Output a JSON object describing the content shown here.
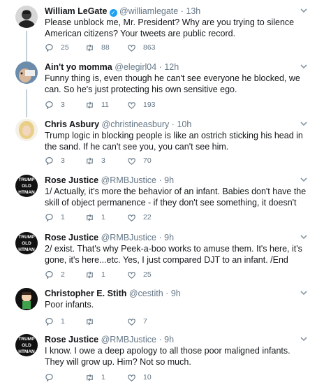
{
  "tweets": [
    {
      "name": "William LeGate",
      "verified": true,
      "handle": "@williamlegate",
      "time": "13h",
      "text": "Please unblock me, Mr. President? Why are you trying to silence American citizens? Your tweets are public record.",
      "replies": "25",
      "retweets": "88",
      "likes": "863",
      "avatar": "avatar-photo-man"
    },
    {
      "name": "Ain't yo momma",
      "verified": false,
      "handle": "@elegirl04",
      "time": "12h",
      "text": "Funny thing is, even though he can't see everyone he blocked, we can. So he's just protecting his own sensitive ego.",
      "replies": "3",
      "retweets": "11",
      "likes": "193",
      "avatar": "avatar-photo-face"
    },
    {
      "name": "Chris Asbury",
      "verified": false,
      "handle": "@christineasbury",
      "time": "10h",
      "text": "Trump logic in blocking people is like an ostrich sticking his head in the sand. If he can't see you, you can't see him.",
      "replies": "3",
      "retweets": "3",
      "likes": "70",
      "avatar": "avatar-photo-blonde"
    },
    {
      "name": "Rose Justice",
      "verified": false,
      "handle": "@RMBJustice",
      "time": "9h",
      "text": "1/ Actually, it's more the behavior of an infant. Babies don't have the skill of object permanence - if they don't see something, it doesn't",
      "replies": "1",
      "retweets": "1",
      "likes": "22",
      "avatar": "avatar-logo-text"
    },
    {
      "name": "Rose Justice",
      "verified": false,
      "handle": "@RMBJustice",
      "time": "9h",
      "text": "2/ exist. That's why Peek-a-boo works to amuse them. It's here, it's gone, it's here...etc. Yes, I just compared DJT to an infant. /End",
      "replies": "2",
      "retweets": "1",
      "likes": "25",
      "avatar": "avatar-logo-text"
    },
    {
      "name": "Christopher E. Stith",
      "verified": false,
      "handle": "@cestith",
      "time": "9h",
      "text": "Poor infants.",
      "replies": "1",
      "retweets": "",
      "likes": "7",
      "avatar": "avatar-cartoon"
    },
    {
      "name": "Rose Justice",
      "verified": false,
      "handle": "@RMBJustice",
      "time": "9h",
      "text": "I know. I owe a deep apology to all those poor maligned infants. They will grow up. Him? Not so much.",
      "replies": "",
      "retweets": "1",
      "likes": "10",
      "avatar": "avatar-logo-text"
    }
  ],
  "separator": "·",
  "avatar_logo_lines": [
    "TRUMP",
    "OLD",
    "HTMAN"
  ],
  "colors": {
    "name": "#14171a",
    "meta": "#657786",
    "verified": "#1da1f2",
    "thread_line": "#c4cfd6"
  }
}
